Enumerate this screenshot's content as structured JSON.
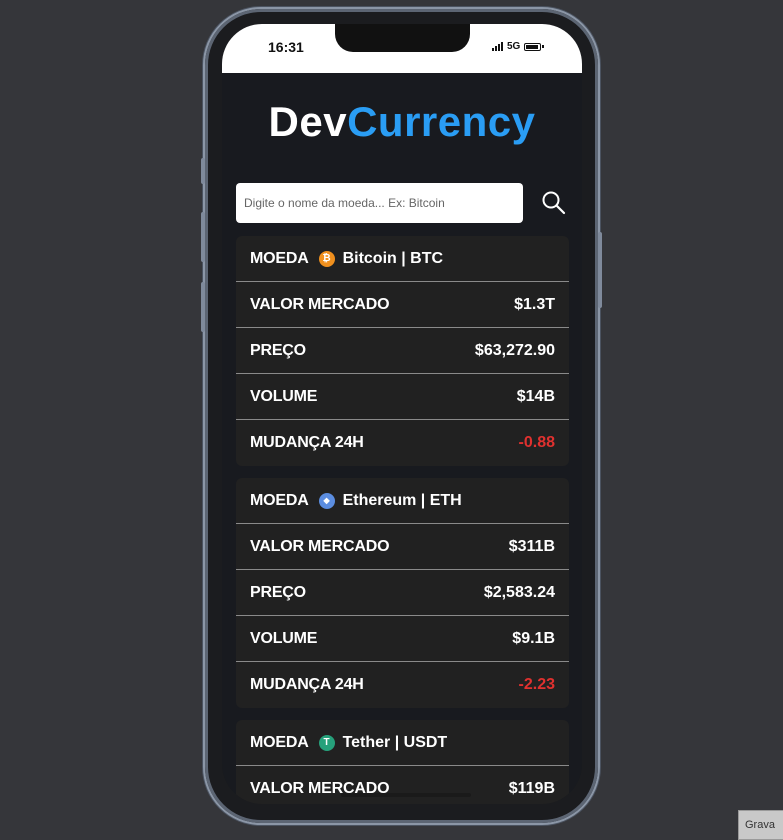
{
  "status_bar": {
    "time": "16:31",
    "network": "5G"
  },
  "logo": {
    "part1": "Dev",
    "part2": "Currency"
  },
  "search": {
    "placeholder": "Digite o nome da moeda... Ex: Bitcoin",
    "value": ""
  },
  "labels": {
    "coin": "MOEDA",
    "market_cap": "VALOR MERCADO",
    "price": "PREÇO",
    "volume": "VOLUME",
    "change": "MUDANÇA 24H"
  },
  "coins": [
    {
      "name": "Bitcoin | BTC",
      "icon": "bitcoin-icon",
      "icon_color": "#f0901e",
      "icon_glyph": "₿",
      "market_cap": "$1.3T",
      "price": "$63,272.90",
      "volume": "$14B",
      "change": "-0.88"
    },
    {
      "name": "Ethereum | ETH",
      "icon": "ethereum-icon",
      "icon_color": "#5b8de0",
      "icon_glyph": "◆",
      "market_cap": "$311B",
      "price": "$2,583.24",
      "volume": "$9.1B",
      "change": "-2.23"
    },
    {
      "name": "Tether | USDT",
      "icon": "tether-icon",
      "icon_color": "#26a17b",
      "icon_glyph": "T",
      "market_cap": "$119B"
    }
  ],
  "colors": {
    "accent": "#2a9df4",
    "negative": "#e0312f",
    "card": "#212121",
    "background": "#181a1f"
  },
  "corner_tab": {
    "text": "Grava"
  }
}
